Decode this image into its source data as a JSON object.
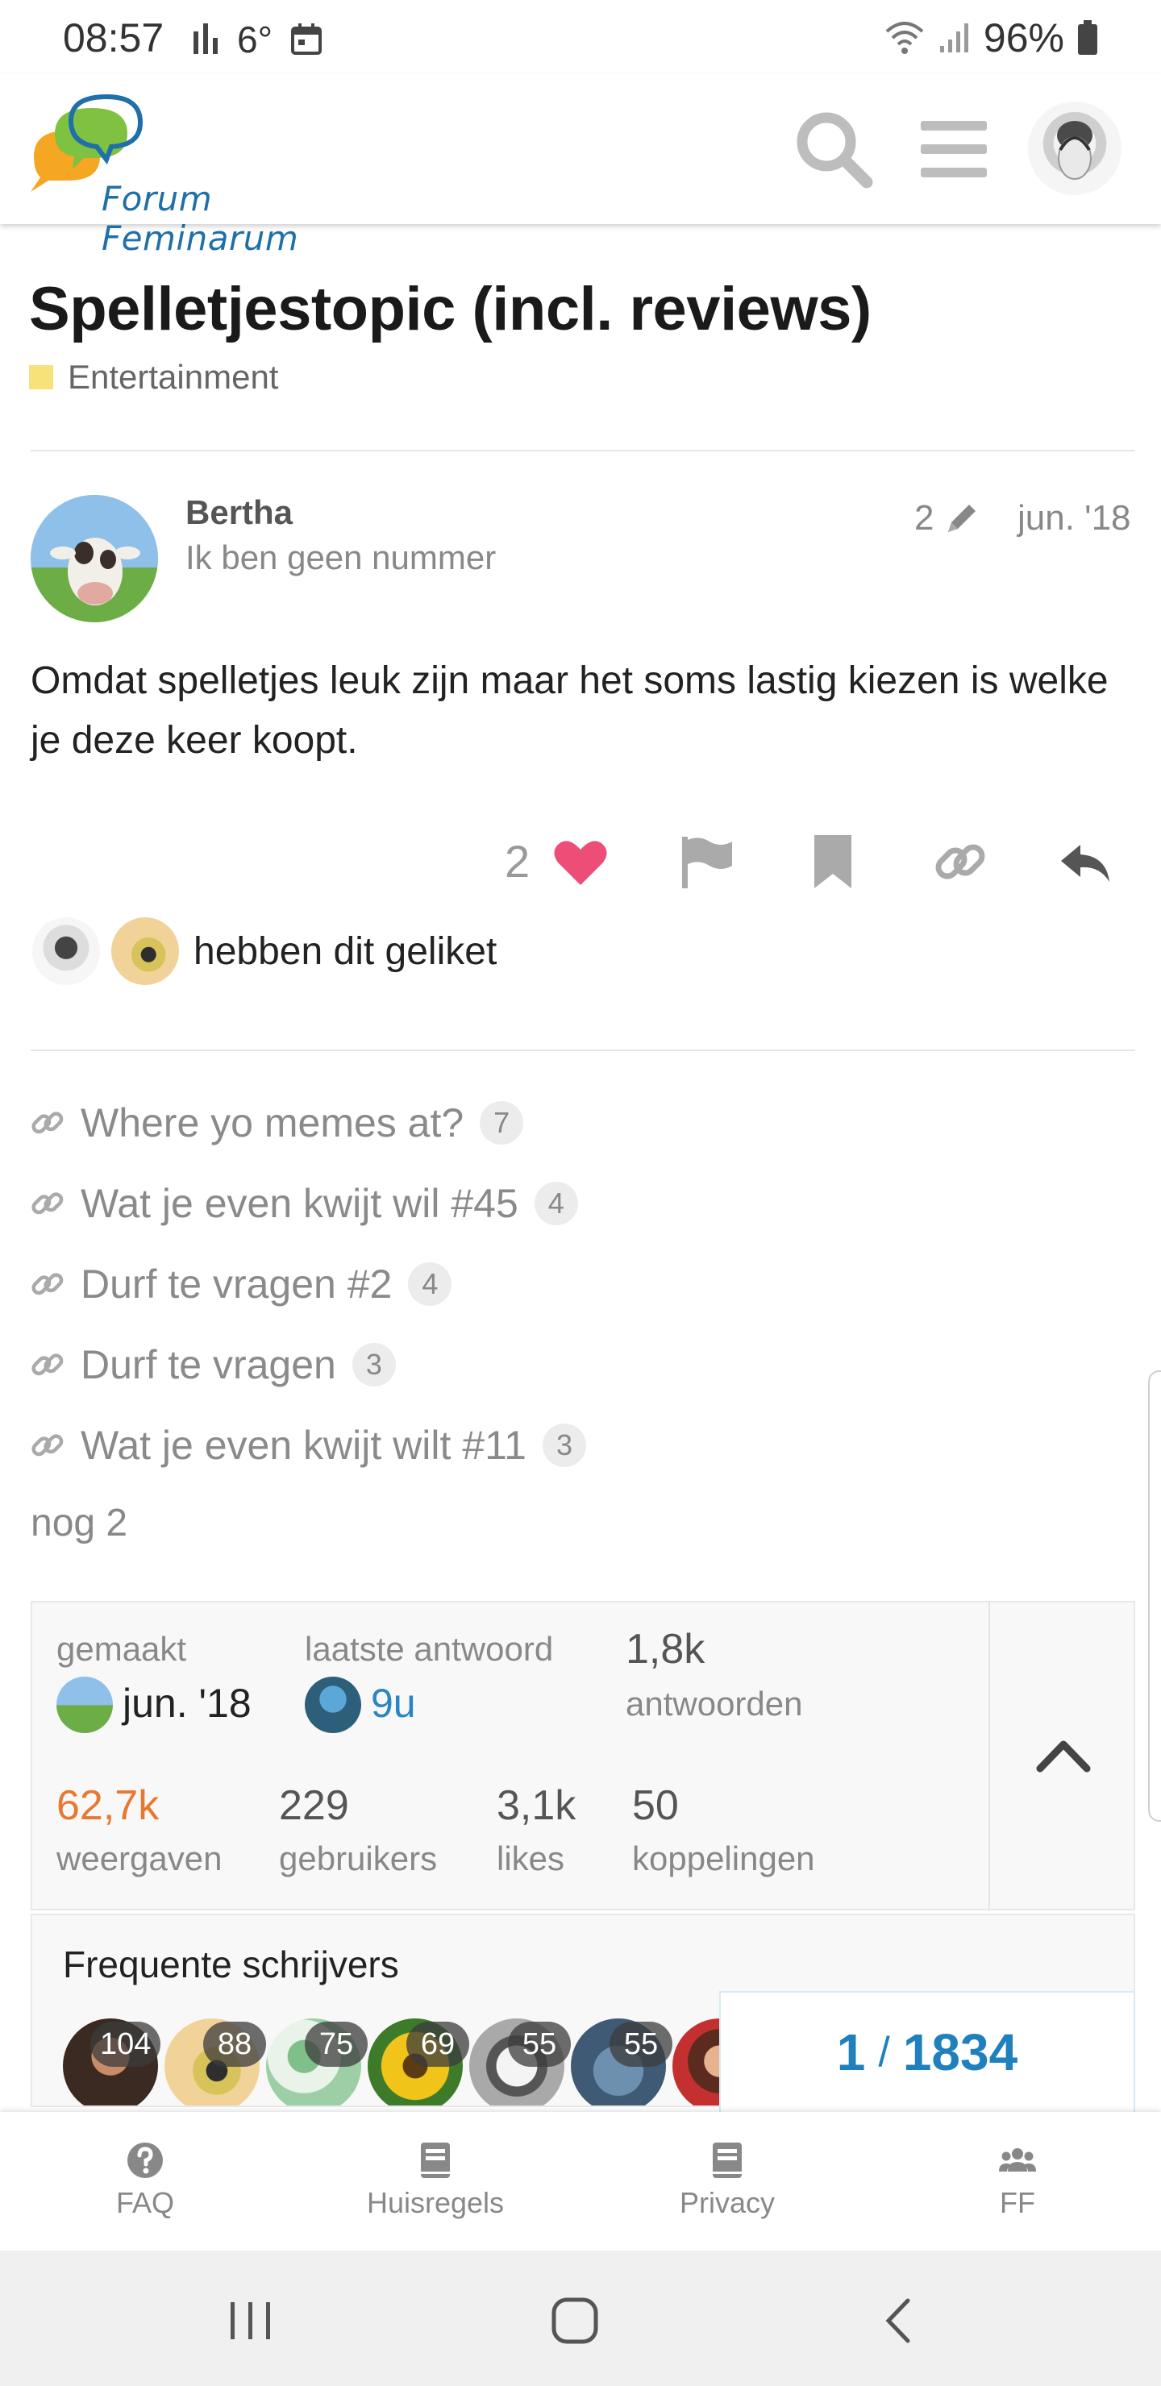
{
  "status_bar": {
    "time": "08:57",
    "temperature": "6°",
    "battery": "96%"
  },
  "header": {
    "logo_text": "Forum Feminarum",
    "brand_colors": {
      "bubble_orange": "#f5a623",
      "bubble_green": "#7fc241",
      "bubble_blue": "#1f6fa9"
    }
  },
  "topic": {
    "title": "Spelletjestopic (incl. reviews)",
    "category": "Entertainment",
    "category_color": "#f7e27a"
  },
  "post": {
    "username": "Bertha",
    "user_title": "Ik ben geen nummer",
    "edit_count": "2",
    "date": "jun. '18",
    "body": "Omdat spelletjes leuk zijn maar het soms lastig kiezen is welke je deze keer koopt.",
    "like_count": "2",
    "likers_text": "hebben dit geliket"
  },
  "links": [
    {
      "title": "Where yo memes at?",
      "count": "7"
    },
    {
      "title": "Wat je even kwijt wil #45",
      "count": "4"
    },
    {
      "title": "Durf te vragen #2",
      "count": "4"
    },
    {
      "title": "Durf te vragen",
      "count": "3"
    },
    {
      "title": "Wat je even kwijt wilt #11",
      "count": "3"
    }
  ],
  "links_more": "nog 2",
  "topic_map": {
    "created_label": "gemaakt",
    "created_value": "jun. '18",
    "last_reply_label": "laatste antwoord",
    "last_reply_value": "9u",
    "replies_value": "1,8k",
    "replies_label": "antwoorden",
    "views_value": "62,7k",
    "views_label": "weergaven",
    "users_value": "229",
    "users_label": "gebruikers",
    "likes_value": "3,1k",
    "likes_label": "likes",
    "links_value": "50",
    "links_label": "koppelingen"
  },
  "frequent_writers": {
    "title": "Frequente schrijvers",
    "counts": [
      "104",
      "88",
      "75",
      "69",
      "55",
      "55"
    ]
  },
  "progress": {
    "current": "1",
    "separator": "/",
    "total": "1834"
  },
  "footer_nav": [
    {
      "label": "FAQ",
      "icon": "question-circle-icon"
    },
    {
      "label": "Huisregels",
      "icon": "book-icon"
    },
    {
      "label": "Privacy",
      "icon": "book-icon"
    },
    {
      "label": "FF",
      "icon": "users-icon"
    }
  ]
}
